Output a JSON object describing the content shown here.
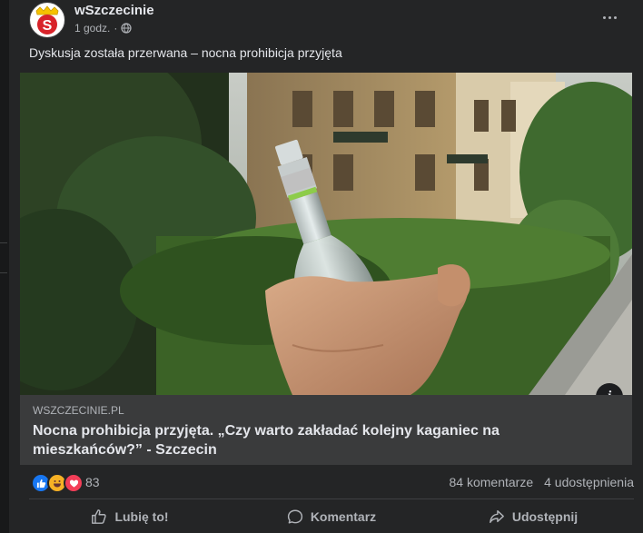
{
  "post": {
    "page_name": "wSzczecinie",
    "time": "1 godz.",
    "dot": "·",
    "audience_icon": "globe-icon",
    "text": "Dyskusja została przerwana – nocna prohibicja przyjęta",
    "logo_letter": "S"
  },
  "link_preview": {
    "domain": "WSZCZECINIE.PL",
    "title": "Nocna prohibicja przyjęta. „Czy warto zakładać kolejny kaganiec na mieszkańców?” - Szczecin",
    "info_label": "i"
  },
  "stats": {
    "reactions": [
      "like",
      "haha",
      "love"
    ],
    "reaction_count": "83",
    "comments": "84 komentarze",
    "shares": "4 udostępnienia"
  },
  "actions": {
    "like": "Lubię to!",
    "comment": "Komentarz",
    "share": "Udostępnij"
  },
  "colors": {
    "card": "#242526",
    "like_blue": "#1877f2",
    "love_red": "#f33e58",
    "haha_yellow": "#f7b125"
  }
}
